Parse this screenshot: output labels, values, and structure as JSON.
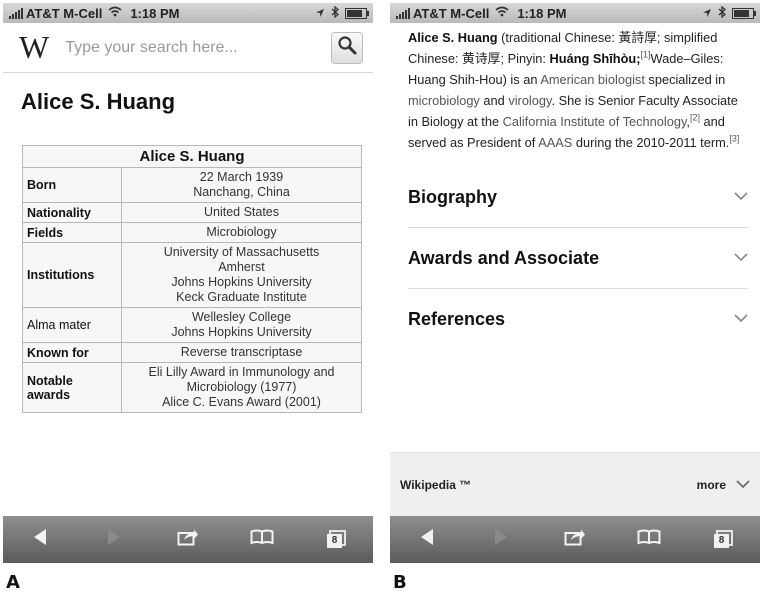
{
  "status": {
    "carrier": "AT&T M-Cell",
    "time": "1:18 PM"
  },
  "panel_a": {
    "panel_label": "A",
    "search": {
      "placeholder": "Type your search here..."
    },
    "page_title": "Alice S. Huang",
    "infobox": {
      "title": "Alice S. Huang",
      "rows": [
        {
          "label": "Born",
          "lines": [
            "22 March 1939",
            "Nanchang, China"
          ]
        },
        {
          "label": "Nationality",
          "lines": [
            "United States"
          ]
        },
        {
          "label": "Fields",
          "lines": [
            "Microbiology"
          ]
        },
        {
          "label": "Institutions",
          "lines": [
            "University of Massachusetts",
            "Amherst",
            "Johns Hopkins University",
            "Keck Graduate Institute"
          ]
        },
        {
          "label": "Alma mater",
          "lines": [
            "Wellesley College",
            "Johns Hopkins University"
          ]
        },
        {
          "label": "Known for",
          "lines": [
            "Reverse transcriptase"
          ]
        },
        {
          "label": "Notable awards",
          "lines": [
            "Eli Lilly Award in Immunology and",
            "Microbiology (1977)",
            "Alice C. Evans Award (2001)"
          ]
        }
      ]
    }
  },
  "panel_b": {
    "panel_label": "B",
    "article": {
      "name": "Alice S. Huang",
      "t1": " (traditional Chinese: 黃詩厚; simplified Chinese: 黄诗厚; Pinyin: ",
      "pinyin": "Huáng Shīhòu;",
      "ref1": "[1]",
      "t2": "Wade–Giles: Huang Shih-Hou) is an ",
      "link_american_biologist": "American biologist",
      "t3": " specialized in ",
      "link_microbiology": "microbiology",
      "t4": " and ",
      "link_virology": "virology",
      "t5": ". She is Senior Faculty Associate in Biology at the ",
      "link_caltech": "California Institute of Technology",
      "t6": ",",
      "ref2": "[2]",
      "t7": " and served as President of ",
      "link_aaas": "AAAS",
      "t8": " during the 2010-2011 term.",
      "ref3": "[3]"
    },
    "sections": [
      "Biography",
      "Awards and Associate",
      "References"
    ],
    "footer": {
      "brand": "Wikipedia ™",
      "more": "more"
    }
  },
  "toolbar": {
    "tabs_count": "8",
    "icons": [
      "back-icon",
      "forward-icon",
      "share-icon",
      "bookmarks-icon",
      "tabs-icon"
    ]
  },
  "colors": {
    "link": "#555555",
    "toolbar": "#6e6e6e"
  }
}
